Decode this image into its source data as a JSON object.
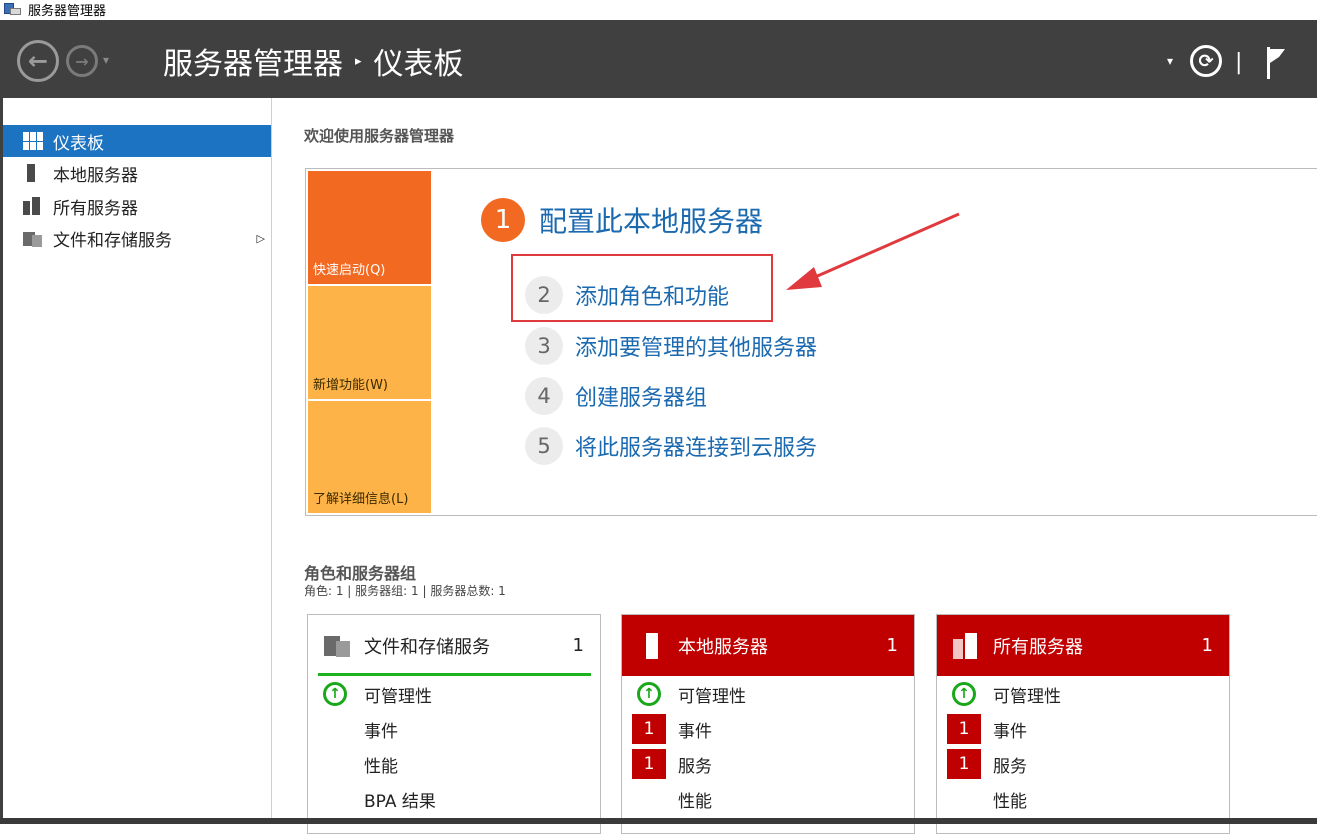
{
  "window": {
    "title": "服务器管理器"
  },
  "header": {
    "app_name": "服务器管理器",
    "separator": "▸",
    "page": "仪表板"
  },
  "sidebar": {
    "items": [
      {
        "label": "仪表板",
        "icon": "dashboard-icon",
        "active": true
      },
      {
        "label": "本地服务器",
        "icon": "server-icon"
      },
      {
        "label": "所有服务器",
        "icon": "servers-icon"
      },
      {
        "label": "文件和存储服务",
        "icon": "storage-icon",
        "expandable": true
      }
    ]
  },
  "welcome": {
    "heading": "欢迎使用服务器管理器",
    "tiles": [
      "快速启动(Q)",
      "新增功能(W)",
      "了解详细信息(L)"
    ],
    "main_step": {
      "num": "1",
      "label": "配置此本地服务器"
    },
    "steps": [
      {
        "num": "2",
        "label": "添加角色和功能"
      },
      {
        "num": "3",
        "label": "添加要管理的其他服务器"
      },
      {
        "num": "4",
        "label": "创建服务器组"
      },
      {
        "num": "5",
        "label": "将此服务器连接到云服务"
      }
    ],
    "colors": {
      "accent_orange": "#f26a22",
      "tile_light": "#fdb347",
      "link": "#1b6ab0",
      "annotation": "#e0393e"
    }
  },
  "roles": {
    "heading": "角色和服务器组",
    "summary": "角色: 1 | 服务器组: 1 | 服务器总数: 1",
    "cards": [
      {
        "name": "文件和存储服务",
        "count": "1",
        "status": "ok",
        "rows": [
          {
            "label": "可管理性",
            "ok": true
          },
          {
            "label": "事件"
          },
          {
            "label": "性能"
          },
          {
            "label": "BPA 结果"
          }
        ]
      },
      {
        "name": "本地服务器",
        "count": "1",
        "status": "alert",
        "rows": [
          {
            "label": "可管理性",
            "ok": true
          },
          {
            "label": "事件",
            "badge": "1"
          },
          {
            "label": "服务",
            "badge": "1"
          },
          {
            "label": "性能"
          }
        ]
      },
      {
        "name": "所有服务器",
        "count": "1",
        "status": "alert",
        "rows": [
          {
            "label": "可管理性",
            "ok": true
          },
          {
            "label": "事件",
            "badge": "1"
          },
          {
            "label": "服务",
            "badge": "1"
          },
          {
            "label": "性能"
          }
        ]
      }
    ],
    "colors": {
      "alert": "#c00000",
      "ok": "#1aa71a"
    }
  }
}
